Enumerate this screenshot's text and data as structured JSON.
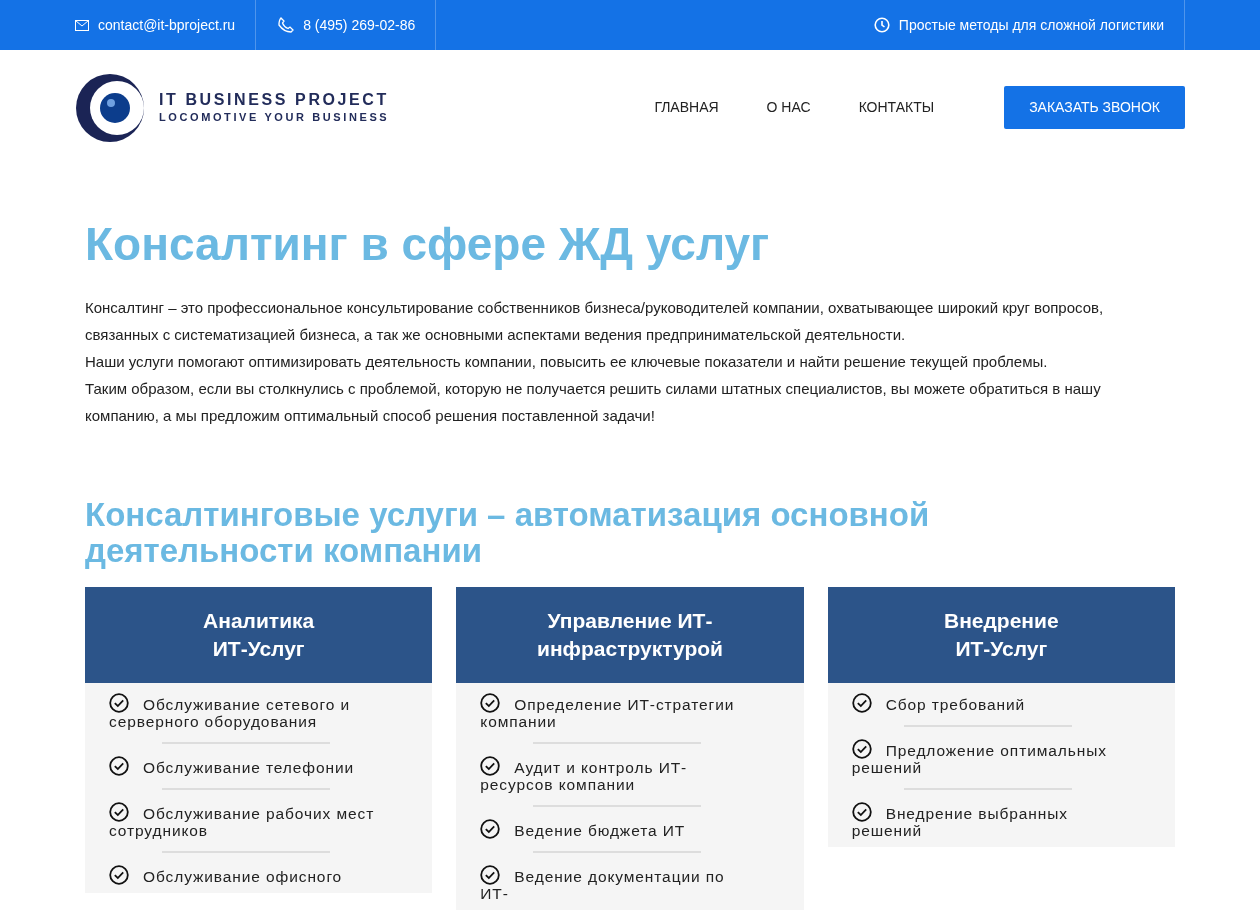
{
  "top_bar": {
    "email": "contact@it-bproject.ru",
    "phone": "8 (495) 269-02-86",
    "slogan": "Простые методы для сложной логистики"
  },
  "header": {
    "logo_title": "IT BUSINESS PROJECT",
    "logo_subtitle": "LOCOMOTIVE YOUR BUSINESS",
    "nav": [
      "ГЛАВНАЯ",
      "О НАС",
      "КОНТАКТЫ"
    ],
    "cta": "ЗАКАЗАТЬ ЗВОНОК"
  },
  "page_title": "Консалтинг в сфере ЖД услуг",
  "intro": [
    "Консалтинг – это профессиональное консультирование собственников бизнеса/руководителей компании, охватывающее широкий круг вопросов, связанных с систематизацией бизнеса, а так же основными аспектами ведения предпринимательской деятельности.",
    "Наши услуги помогают оптимизировать деятельность компании, повысить ее ключевые показатели и найти решение текущей проблемы.",
    "Таким образом, если вы столкнулись с проблемой, которую не получается решить силами штатных специалистов, вы можете обратиться в нашу компанию, а мы предложим оптимальный способ решения поставленной задачи!"
  ],
  "section_title": "Консалтинговые услуги – автоматизация основной деятельности компании",
  "cards": [
    {
      "title_lines": [
        "Аналитика",
        "ИТ-Услуг"
      ],
      "items": [
        "Обслуживание сетевого и серверного оборудования",
        "Обслуживание телефонии",
        "Обслуживание рабочих мест сотрудников",
        "Обслуживание офисного"
      ]
    },
    {
      "title_lines": [
        "Управление ИТ-",
        "инфраструктурой"
      ],
      "items": [
        "Определение ИТ-стратегии компании",
        "Аудит и контроль ИТ-ресурсов компании",
        "Ведение бюджета ИТ",
        "Ведение документации по ИТ-"
      ]
    },
    {
      "title_lines": [
        "Внедрение",
        "ИТ-Услуг"
      ],
      "items": [
        "Сбор требований",
        "Предложение оптимальных решений",
        "Внедрение выбранных решений"
      ]
    }
  ]
}
